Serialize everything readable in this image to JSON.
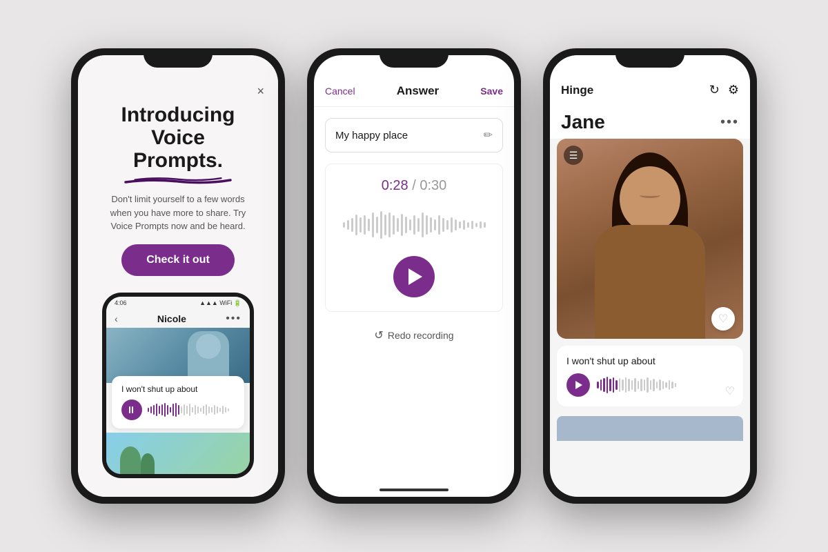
{
  "background": "#e8e6e6",
  "accent_color": "#7b2d8b",
  "phones": {
    "phone1": {
      "close_icon": "×",
      "title_line1": "Introducing",
      "title_line2": "Voice Prompts.",
      "description": "Don't limit yourself to a few words when you have more to share. Try Voice Prompts now and be heard.",
      "cta_button": "Check it out",
      "mini_phone": {
        "status_time": "4:06",
        "profile_name": "Nicole",
        "dots": "•••"
      },
      "voice_card": {
        "text": "I won't shut up about"
      }
    },
    "phone2": {
      "header": {
        "cancel": "Cancel",
        "title": "Answer",
        "save": "Save"
      },
      "prompt": "My happy place",
      "timer": "0:28",
      "timer_total": "0:30",
      "redo_label": "Redo recording"
    },
    "phone3": {
      "header": {
        "app_name": "Hinge",
        "refresh_icon": "↻",
        "settings_icon": "⚙"
      },
      "profile_name": "Jane",
      "dots": "•••",
      "voice_card": {
        "text": "I won't shut up about"
      }
    }
  }
}
